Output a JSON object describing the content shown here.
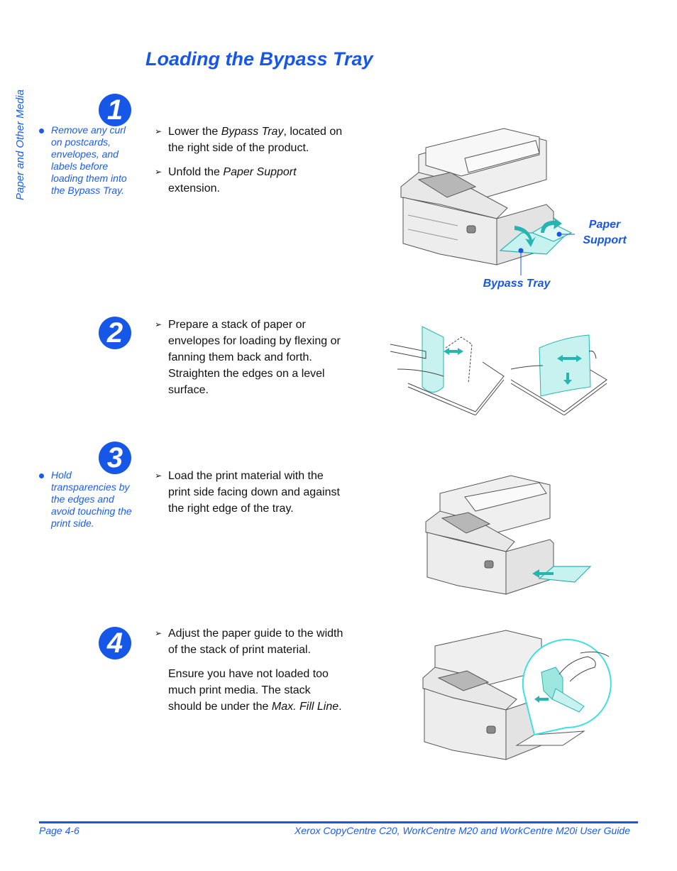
{
  "side_tab": "Paper and Other Media",
  "title": "Loading the Bypass Tray",
  "colors": {
    "accent": "#1757e8",
    "teal": "#26b5b0",
    "paper": "#c8f2f0"
  },
  "steps": [
    {
      "number": "1",
      "note": "Remove any curl on postcards, envelopes, and labels before loading them into the Bypass Tray.",
      "instructions": [
        {
          "pre": "Lower the ",
          "em": "Bypass Tray",
          "post": ", located on the right side of the product."
        },
        {
          "pre": "Unfold the ",
          "em": "Paper Support",
          "post": " extension."
        }
      ],
      "figure": {
        "description": "copier-with-bypass-tray-and-paper-support",
        "callouts": {
          "paper_support_line1": "Paper",
          "paper_support_line2": "Support",
          "bypass_tray": "Bypass Tray"
        }
      }
    },
    {
      "number": "2",
      "instructions": [
        {
          "pre": "Prepare a stack of paper or envelopes for loading by flexing or fanning them back and forth. Straighten the edges on a level surface.",
          "em": "",
          "post": ""
        }
      ],
      "figure": {
        "description": "hands-fanning-paper-stack"
      }
    },
    {
      "number": "3",
      "note": "Hold transparencies by the edges and avoid touching the print side.",
      "instructions": [
        {
          "pre": "Load the print material with the print side facing down and against the right edge of the tray.",
          "em": "",
          "post": ""
        }
      ],
      "figure": {
        "description": "copier-loading-paper-into-bypass-tray"
      }
    },
    {
      "number": "4",
      "instructions": [
        {
          "pre": "Adjust the paper guide to the width of the stack of print material.",
          "em": "",
          "post": ""
        }
      ],
      "paragraph": {
        "pre": "Ensure you have not loaded too much print media. The stack should be under the ",
        "em": "Max. Fill Line",
        "post": "."
      },
      "figure": {
        "description": "copier-with-paper-guide-detail"
      }
    }
  ],
  "footer": {
    "page": "Page 4-6",
    "guide": "Xerox CopyCentre C20, WorkCentre M20 and WorkCentre M20i User Guide"
  }
}
